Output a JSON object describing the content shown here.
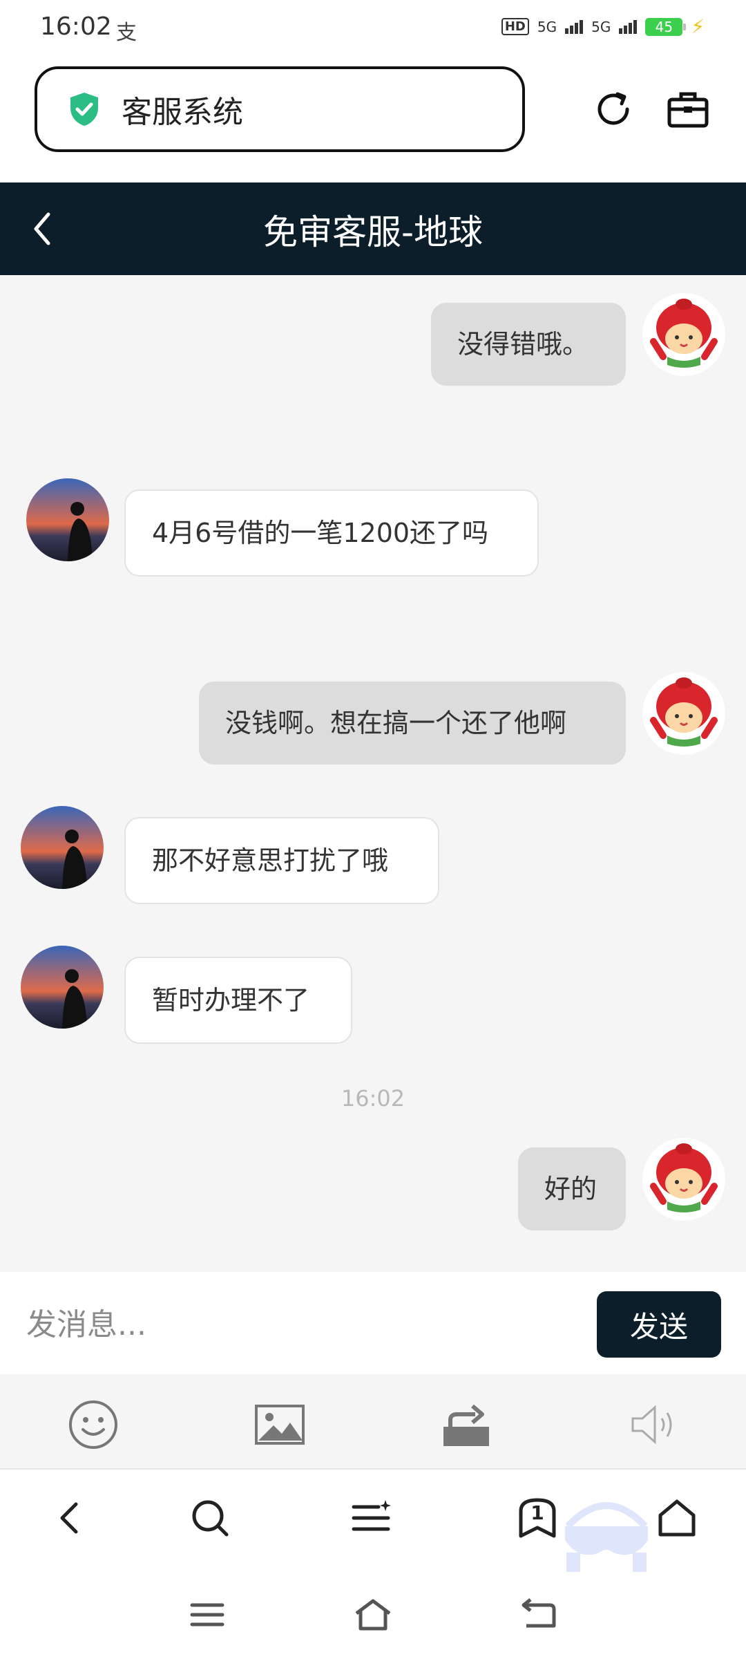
{
  "status_bar": {
    "time": "16:02",
    "app_glyph": "支",
    "battery": "45",
    "network": "5G"
  },
  "browser": {
    "address_text": "客服系统",
    "icons": [
      "shield-check-icon",
      "reload-icon",
      "toolbox-icon"
    ]
  },
  "chat": {
    "title": "免审客服-地球",
    "messages": [
      {
        "from": "me",
        "text": "没得错哦。"
      },
      {
        "from": "them",
        "text": "4月6号借的一笔1200还了吗"
      },
      {
        "from": "me",
        "text": "没钱啊。想在搞一个还了他啊"
      },
      {
        "from": "them",
        "text": "那不好意思打扰了哦"
      },
      {
        "from": "them",
        "text": "暂时办理不了"
      },
      {
        "from": "me",
        "text": "好的"
      }
    ],
    "timestamp": "16:02"
  },
  "composer": {
    "placeholder": "发消息...",
    "send_label": "发送"
  },
  "tools": [
    "emoji-icon",
    "image-icon",
    "share-icon",
    "speaker-icon"
  ],
  "browser_nav": {
    "tab_count": "1"
  },
  "colors": {
    "header_bg": "#0b1e29",
    "chat_bg": "#f5f5f5",
    "my_bubble": "#dcdcdc",
    "their_bubble": "#ffffff",
    "shield": "#2bbd83"
  }
}
